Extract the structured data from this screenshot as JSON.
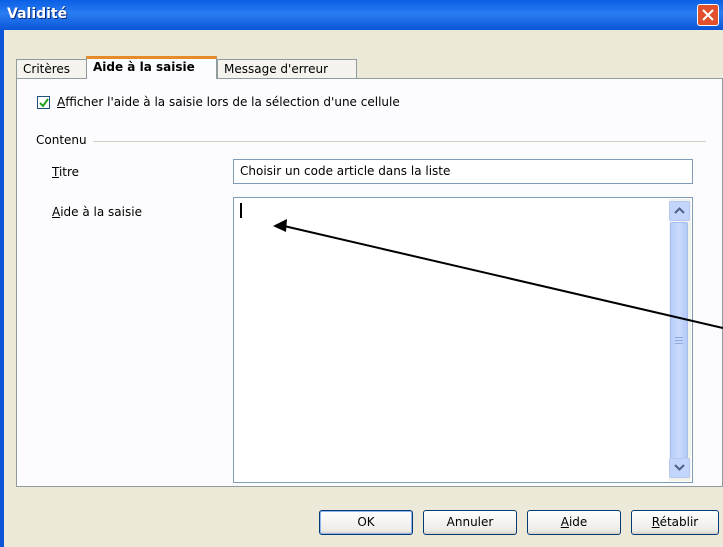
{
  "window": {
    "title": "Validité"
  },
  "tabs": [
    {
      "label": "Critères",
      "active": false
    },
    {
      "label": "Aide à la saisie",
      "active": true
    },
    {
      "label": "Message d'erreur",
      "active": false
    }
  ],
  "show_help": {
    "checked": true,
    "label_accel": "A",
    "label_rest": "fficher l'aide à la saisie lors de la sélection d'une cellule"
  },
  "contents_group": {
    "label": "Contenu"
  },
  "title_field": {
    "label_accel": "T",
    "label_rest": "itre",
    "value": "Choisir un code article dans la liste"
  },
  "help_field": {
    "label_accel": "A",
    "label_rest": "ide à la saisie",
    "value": ""
  },
  "buttons": {
    "ok": "OK",
    "cancel": "Annuler",
    "help_accel": "A",
    "help_rest": "ide",
    "reset_accel": "R",
    "reset_rest": "établir"
  },
  "colors": {
    "titlebar": "#0a5fe4",
    "dialog_bg": "#ece9d8",
    "tab_highlight": "#e68b2c",
    "close_button": "#e0512c"
  },
  "icons": {
    "close": "close-icon",
    "check": "checkmark-icon",
    "scroll_up": "chevron-up-icon",
    "scroll_down": "chevron-down-icon"
  }
}
